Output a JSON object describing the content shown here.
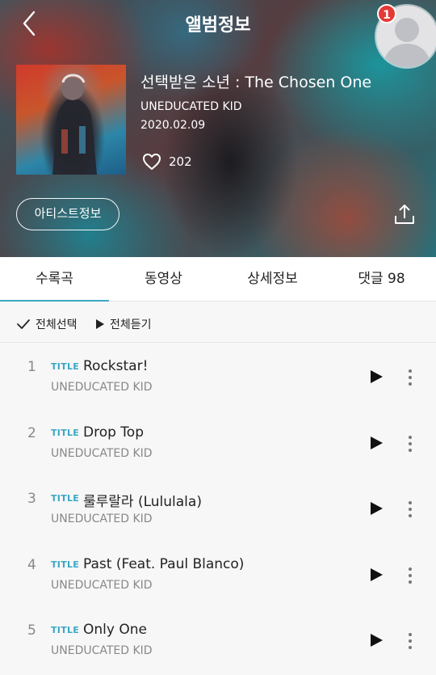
{
  "header": {
    "title": "앨범정보",
    "notification_count": "1"
  },
  "album": {
    "title": "선택받은 소년 : The Chosen One",
    "artist": "UNEDUCATED KID",
    "release_date": "2020.02.09",
    "likes": "202",
    "artist_info_label": "아티스트정보"
  },
  "tabs": [
    {
      "label": "수록곡"
    },
    {
      "label": "동영상"
    },
    {
      "label": "상세정보"
    },
    {
      "label": "댓글 98"
    }
  ],
  "actions": {
    "select_all": "전체선택",
    "play_all": "전체듣기"
  },
  "tracks": [
    {
      "num": "1",
      "tag": "TITLE",
      "title": "Rockstar!",
      "artist": "UNEDUCATED KID"
    },
    {
      "num": "2",
      "tag": "TITLE",
      "title": "Drop Top",
      "artist": "UNEDUCATED KID"
    },
    {
      "num": "3",
      "tag": "TITLE",
      "title": "룰루랄라 (Lululala)",
      "artist": "UNEDUCATED KID"
    },
    {
      "num": "4",
      "tag": "TITLE",
      "title": "Past (Feat. Paul Blanco)",
      "artist": "UNEDUCATED KID"
    },
    {
      "num": "5",
      "tag": "TITLE",
      "title": "Only One",
      "artist": "UNEDUCATED KID"
    }
  ],
  "colors": {
    "accent": "#3aa7c4",
    "badge": "#e53935"
  }
}
